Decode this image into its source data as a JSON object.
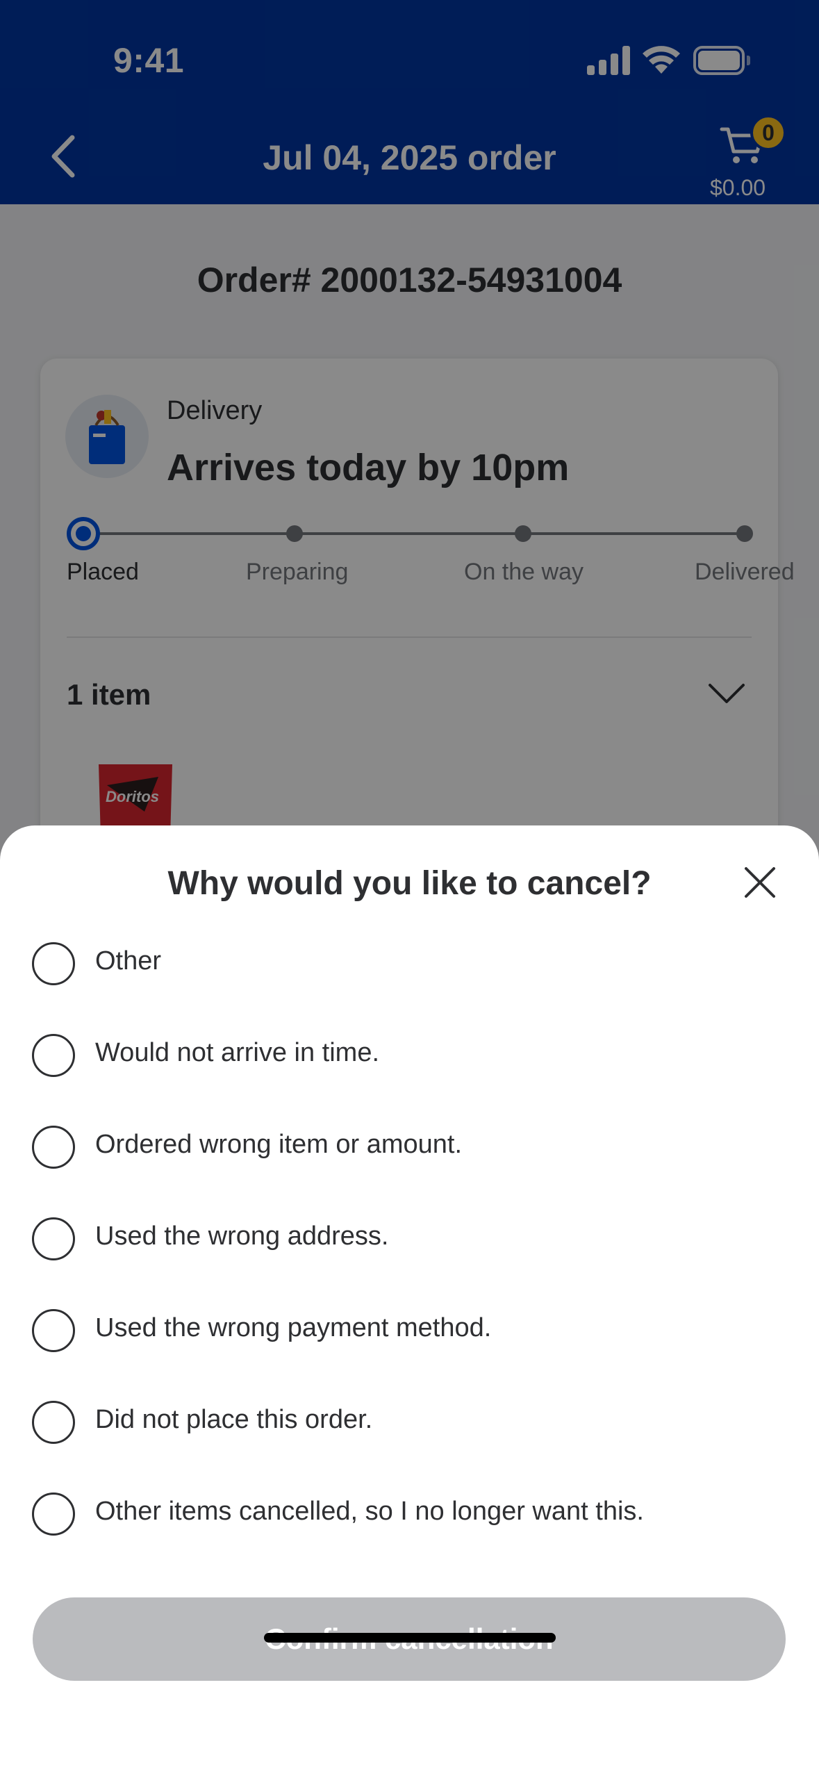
{
  "status_bar": {
    "time": "9:41"
  },
  "header": {
    "title": "Jul 04, 2025 order",
    "cart_count": "0",
    "cart_amount": "$0.00",
    "background_color": "#0035a1"
  },
  "order": {
    "number": "Order# 2000132-54931004",
    "delivery_label": "Delivery",
    "arrival": "Arrives today by 10pm",
    "tracker": {
      "steps": [
        "Placed",
        "Preparing",
        "On the way",
        "Delivered"
      ],
      "active_index": 0
    },
    "items_title": "1 item",
    "product_name": "Doritos"
  },
  "sheet": {
    "title": "Why would you like to cancel?",
    "options": [
      "Other",
      "Would not arrive in time.",
      "Ordered wrong item or amount.",
      "Used the wrong address.",
      "Used the wrong payment method.",
      "Did not place this order.",
      "Other items cancelled, so I no longer want this."
    ],
    "confirm_label": "Confirm cancellation",
    "confirm_enabled": false
  },
  "colors": {
    "accent": "#0053e2",
    "badge": "#ffc220",
    "disabled_button": "#babbbe"
  },
  "icons": [
    "back-arrow-icon",
    "cart-icon",
    "signal-icon",
    "wifi-icon",
    "battery-icon",
    "chevron-down-icon",
    "close-icon"
  ]
}
